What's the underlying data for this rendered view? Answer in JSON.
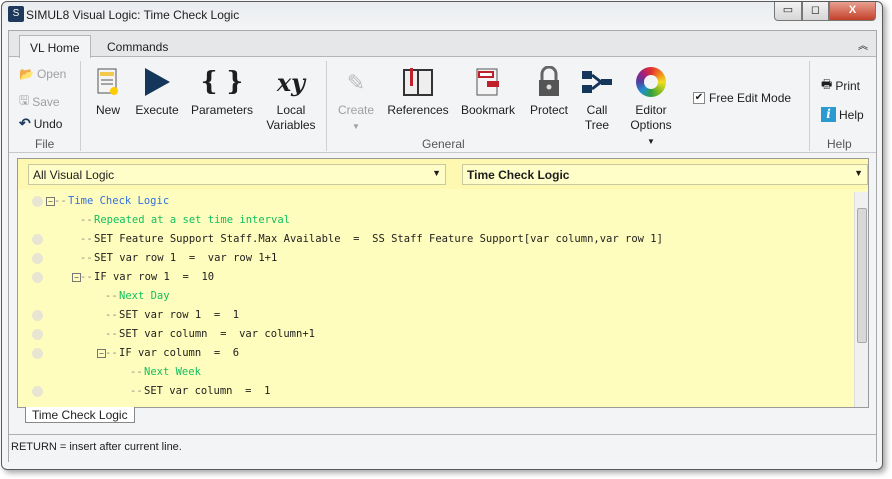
{
  "window": {
    "title": "SIMUL8 Visual Logic: Time Check Logic",
    "min": "▭",
    "max": "◻",
    "close": "X"
  },
  "tabs": [
    {
      "label": "VL Home"
    },
    {
      "label": "Commands"
    }
  ],
  "ribbon": {
    "file": {
      "open": "Open",
      "save": "Save",
      "undo": "Undo",
      "group": "File"
    },
    "general": {
      "new": "New",
      "execute": "Execute",
      "parameters": "Parameters",
      "local1": "Local",
      "local2": "Variables",
      "create": "Create",
      "references": "References",
      "bookmark": "Bookmark",
      "protect": "Protect",
      "call1": "Call",
      "call2": "Tree",
      "editor1": "Editor",
      "editor2": "Options",
      "free_edit": "Free Edit Mode",
      "free_edit_checked": true,
      "group": "General"
    },
    "help": {
      "print": "Print",
      "help": "Help",
      "group": "Help"
    }
  },
  "editor": {
    "scope_dropdown": "All Visual Logic",
    "logic_dropdown": "Time Check Logic",
    "lines": [
      {
        "level": 0,
        "text": "Time Check Logic",
        "kind": "blue",
        "dot": true,
        "box": true
      },
      {
        "level": 1,
        "text": "Repeated at a set time interval",
        "kind": "green",
        "dot": false
      },
      {
        "level": 1,
        "text": "SET Feature Support Staff.Max Available  =  SS Staff Feature Support[var column,var row 1]",
        "kind": "",
        "dot": true
      },
      {
        "level": 1,
        "text": "SET var row 1  =  var row 1+1",
        "kind": "",
        "dot": true
      },
      {
        "level": 1,
        "text": "IF var row 1  =  10",
        "kind": "",
        "dot": true,
        "box": true
      },
      {
        "level": 2,
        "text": "Next Day",
        "kind": "green",
        "dot": false
      },
      {
        "level": 2,
        "text": "SET var row 1  =  1",
        "kind": "",
        "dot": true
      },
      {
        "level": 2,
        "text": "SET var column  =  var column+1",
        "kind": "",
        "dot": true
      },
      {
        "level": 2,
        "text": "IF var column  =  6",
        "kind": "",
        "dot": true,
        "box": true
      },
      {
        "level": 3,
        "text": "Next Week",
        "kind": "green",
        "dot": false
      },
      {
        "level": 3,
        "text": "SET var column  =  1",
        "kind": "",
        "dot": true
      }
    ],
    "sheet_tab": "Time Check Logic"
  },
  "status": "RETURN = insert after current line."
}
